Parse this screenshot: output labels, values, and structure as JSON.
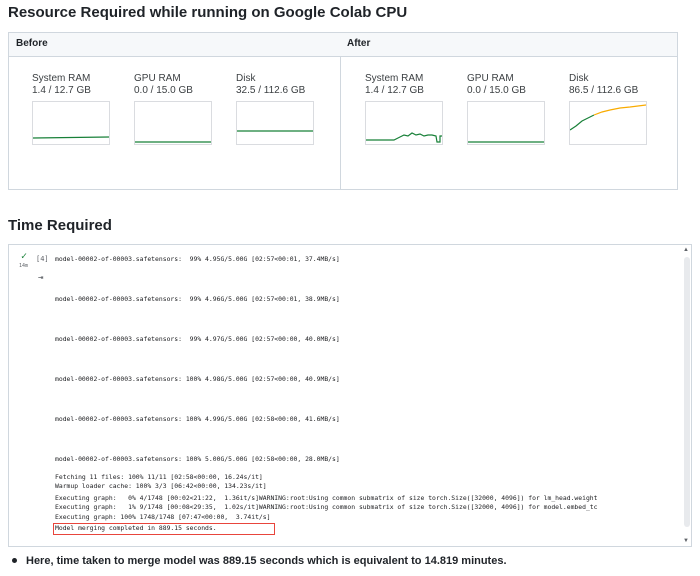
{
  "headings": {
    "resource": "Resource Required while running on Google Colab CPU",
    "time": "Time Required"
  },
  "resources": {
    "before": {
      "label": "Before",
      "system_ram": {
        "label": "System RAM",
        "value": "1.4 / 12.7 GB"
      },
      "gpu_ram": {
        "label": "GPU RAM",
        "value": "0.0 / 15.0 GB"
      },
      "disk": {
        "label": "Disk",
        "value": "32.5 / 112.6 GB"
      }
    },
    "after": {
      "label": "After",
      "system_ram": {
        "label": "System RAM",
        "value": "1.4 / 12.7 GB"
      },
      "gpu_ram": {
        "label": "GPU RAM",
        "value": "0.0 / 15.0 GB"
      },
      "disk": {
        "label": "Disk",
        "value": "86.5 / 112.6 GB"
      }
    },
    "colors": {
      "green": "#188038",
      "orange": "#f9ab00",
      "border": "#dadce0"
    }
  },
  "output": {
    "check_icon": "check-icon",
    "duration": "14m",
    "cell_number": "[4]",
    "output_icon": "output-toggle-icon",
    "lines": [
      "model-00002-of-00003.safetensors:  99% 4.95G/5.00G [02:57<00:01, 37.4MB/s]",
      "model-00002-of-00003.safetensors:  99% 4.96G/5.00G [02:57<00:01, 38.9MB/s]",
      "model-00002-of-00003.safetensors:  99% 4.97G/5.00G [02:57<00:00, 40.0MB/s]",
      "model-00002-of-00003.safetensors: 100% 4.98G/5.00G [02:57<00:00, 40.9MB/s]",
      "model-00002-of-00003.safetensors: 100% 4.99G/5.00G [02:58<00:00, 41.6MB/s]",
      "model-00002-of-00003.safetensors: 100% 5.00G/5.00G [02:58<00:00, 28.0MB/s]",
      "Fetching 11 files: 100% 11/11 [02:58<00:00, 16.24s/it]",
      "Warmup loader cache: 100% 3/3 [06:42<00:00, 134.23s/it]",
      "Executing graph:   0% 4/1748 [00:02<21:22,  1.36it/s]WARNING:root:Using common submatrix of size torch.Size([32000, 4096]) for lm_head.weight",
      "Executing graph:   1% 9/1748 [00:08<29:35,  1.02s/it]WARNING:root:Using common submatrix of size torch.Size([32000, 4096]) for model.embed_tc",
      "Executing graph: 100% 1748/1748 [07:47<00:00,  3.74it/s]",
      "Model merging completed in 889.15 seconds."
    ]
  },
  "summary": "Here, time taken to merge model was 889.15 seconds which is equivalent to 14.819 minutes."
}
